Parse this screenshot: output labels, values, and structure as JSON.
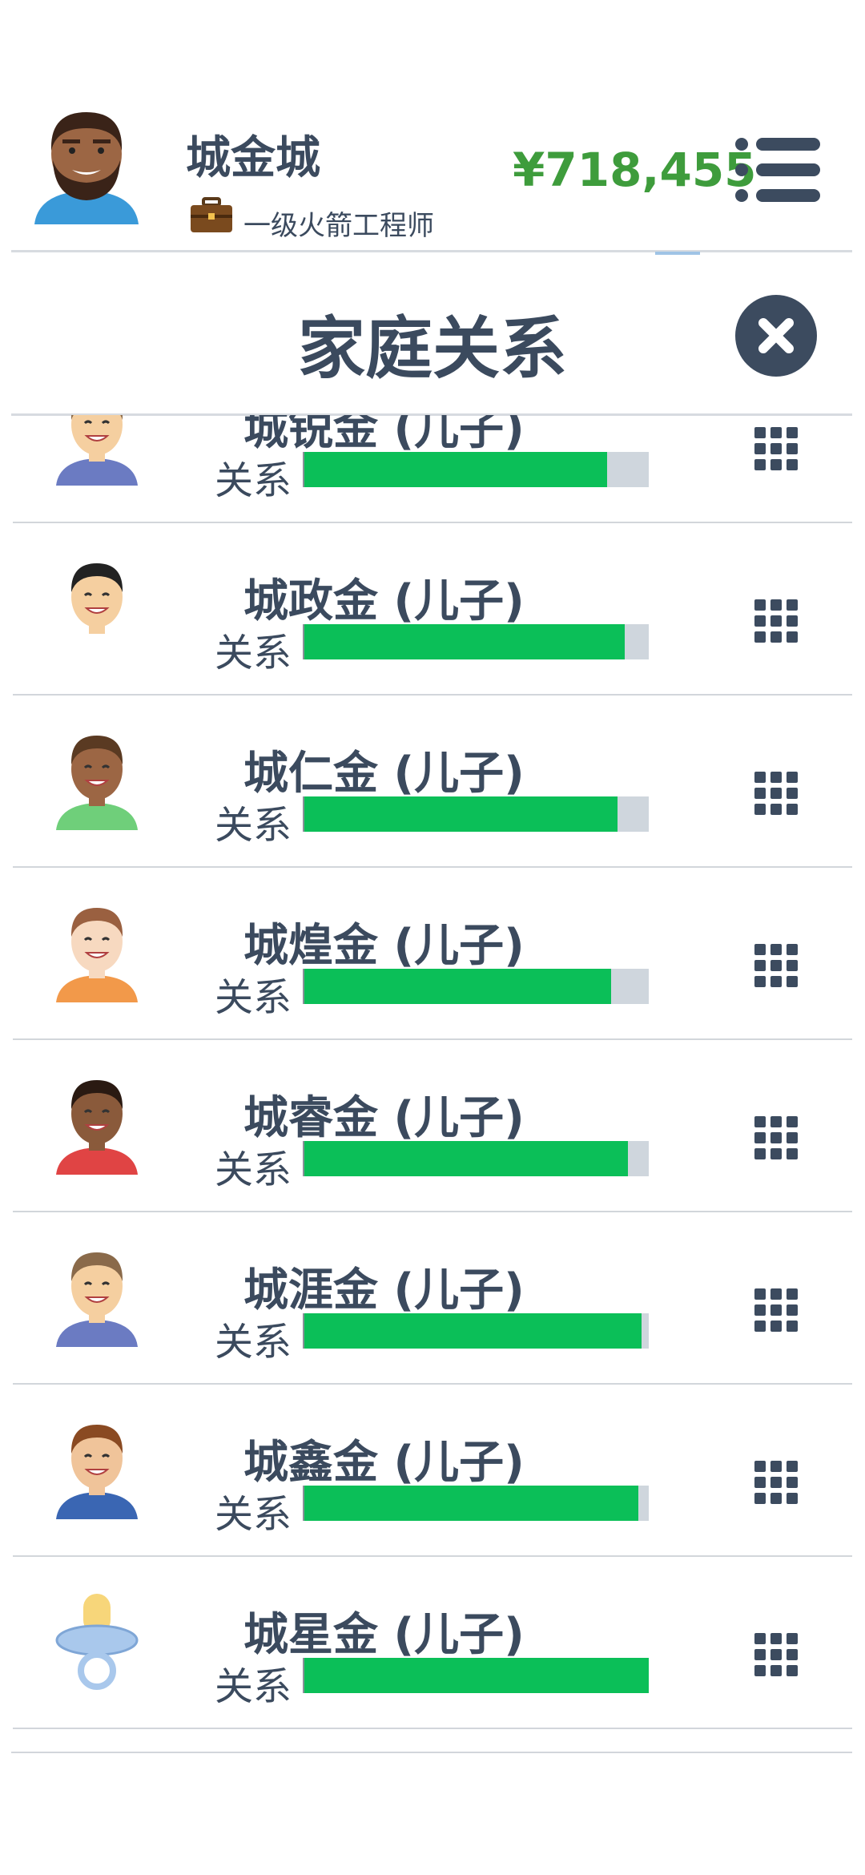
{
  "header": {
    "user_name": "城金城",
    "job_title": "一级火箭工程师",
    "money": "¥718,455"
  },
  "modal": {
    "title": "家庭关系"
  },
  "members": [
    {
      "name": "城锐金 (儿子)",
      "relation_label": "关系",
      "relation": 0.88,
      "avatar": "boy-blue-shirt-icon"
    },
    {
      "name": "城政金 (儿子)",
      "relation_label": "关系",
      "relation": 0.93,
      "avatar": "boy-sailor-icon"
    },
    {
      "name": "城仁金 (儿子)",
      "relation_label": "关系",
      "relation": 0.91,
      "avatar": "boy-green-shirt-icon"
    },
    {
      "name": "城煌金 (儿子)",
      "relation_label": "关系",
      "relation": 0.89,
      "avatar": "boy-striped-shirt-icon"
    },
    {
      "name": "城睿金 (儿子)",
      "relation_label": "关系",
      "relation": 0.94,
      "avatar": "boy-red-shirt-icon"
    },
    {
      "name": "城涯金 (儿子)",
      "relation_label": "关系",
      "relation": 0.98,
      "avatar": "boy-blue-shirt-icon"
    },
    {
      "name": "城鑫金 (儿子)",
      "relation_label": "关系",
      "relation": 0.97,
      "avatar": "boy-overalls-icon"
    },
    {
      "name": "城星金 (儿子)",
      "relation_label": "关系",
      "relation": 1.0,
      "avatar": "pacifier-icon"
    }
  ],
  "colors": {
    "text": "#3b4a5e",
    "money": "#3e9c3c",
    "bar_fill": "#0bbf58",
    "bar_track": "#cfd6dd"
  }
}
